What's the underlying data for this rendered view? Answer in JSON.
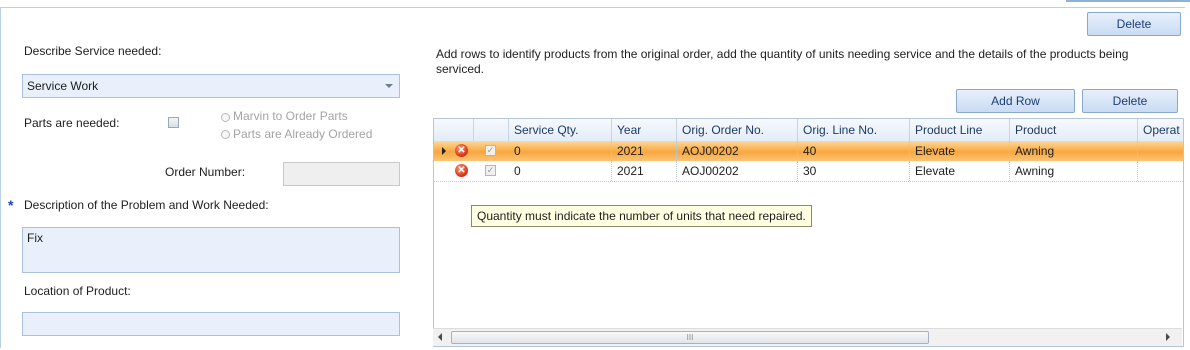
{
  "toolbar": {
    "delete_label": "Delete"
  },
  "left": {
    "service_label": "Describe Service needed:",
    "service_value": "Service Work",
    "parts_label": "Parts are needed:",
    "radio_option1": "Marvin to Order Parts",
    "radio_option2": "Parts are Already Ordered",
    "order_number_label": "Order Number:",
    "order_number_value": "",
    "required_marker": "*",
    "description_label": "Description of the Problem and Work Needed:",
    "description_value": "Fix",
    "location_label": "Location of Product:",
    "location_value": ""
  },
  "right": {
    "instructions": "Add rows to identify products from the original order, add the quantity of units needing service and the details of the products being serviced.",
    "add_row_label": "Add Row",
    "delete_label": "Delete"
  },
  "grid": {
    "columns": [
      "Service Qty.",
      "Year",
      "Orig. Order No.",
      "Orig. Line No.",
      "Product Line",
      "Product",
      "Operat"
    ],
    "rows": [
      {
        "selected": true,
        "cells": [
          "0",
          "2021",
          "AOJ00202",
          "40",
          "Elevate",
          "Awning",
          ""
        ]
      },
      {
        "selected": false,
        "cells": [
          "0",
          "2021",
          "AOJ00202",
          "30",
          "Elevate",
          "Awning",
          ""
        ]
      }
    ],
    "tooltip": "Quantity must indicate the number of units that need repaired.",
    "scroll_grip": "III"
  },
  "colors": {
    "accent": "#1b3d78",
    "selection": "#f7a73e",
    "required": "#1e3fc8",
    "tooltip_bg": "#ffffe1"
  },
  "icons": [
    "delete-row-icon",
    "row-pointer-icon",
    "dropdown-arrow-icon",
    "scroll-left-icon",
    "scroll-right-icon"
  ]
}
